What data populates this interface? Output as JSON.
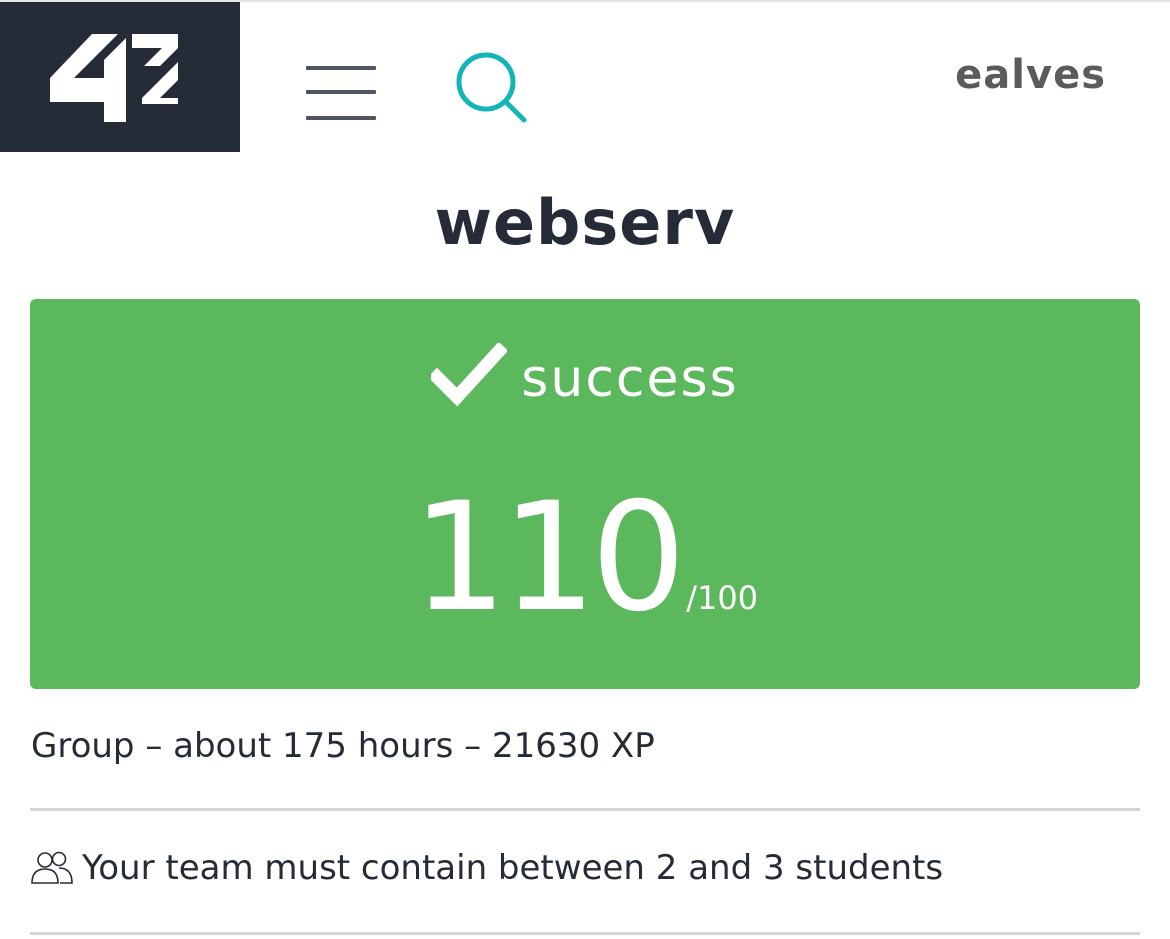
{
  "header": {
    "logo_text": "42",
    "username": "ealves"
  },
  "project": {
    "title": "webserv"
  },
  "result": {
    "status": "success",
    "score": "110",
    "max_score": "/100"
  },
  "details": {
    "info": "Group – about 175 hours – 21630 XP",
    "team_rule": "Your team must contain between 2 and 3 students"
  },
  "colors": {
    "logo_bg": "#262b38",
    "search_icon": "#12b5b8",
    "success_green": "#5cb85c",
    "text_dark": "#262b38",
    "username_gray": "#5b5b5b"
  },
  "icons": {
    "menu": "hamburger-icon",
    "search": "search-icon",
    "status": "checkmark-icon",
    "team": "users-icon"
  }
}
